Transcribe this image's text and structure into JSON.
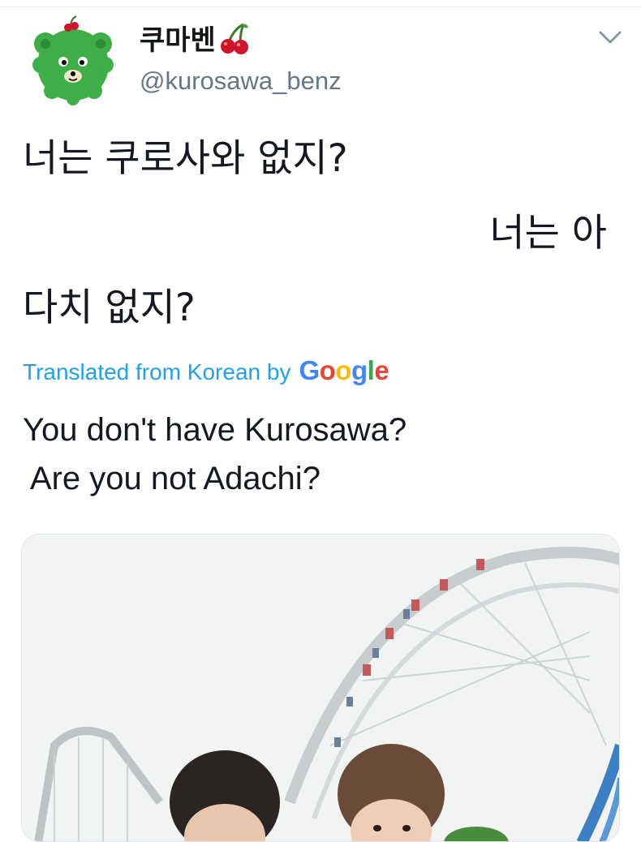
{
  "tweet": {
    "display_name": "쿠마벤",
    "handle": "@kurosawa_benz",
    "text_lines": [
      "너는 쿠로사와 없지?",
      "너는 아",
      "다치 없지?"
    ],
    "translated_label": "Translated from Korean by",
    "google_brand": [
      "G",
      "o",
      "o",
      "g",
      "l",
      "e"
    ],
    "translation_lines": [
      "You don't have Kurosawa?",
      " Are you not Adachi?"
    ]
  },
  "icons": {
    "avatar": "green-bear-avatar",
    "name_emoji": "cherry-icon",
    "menu": "chevron-down-icon"
  },
  "colors": {
    "link_blue": "#1da1f2",
    "handle_gray": "#657786",
    "avatar_green": "#3fae49",
    "cherry_red": "#d0142c"
  }
}
